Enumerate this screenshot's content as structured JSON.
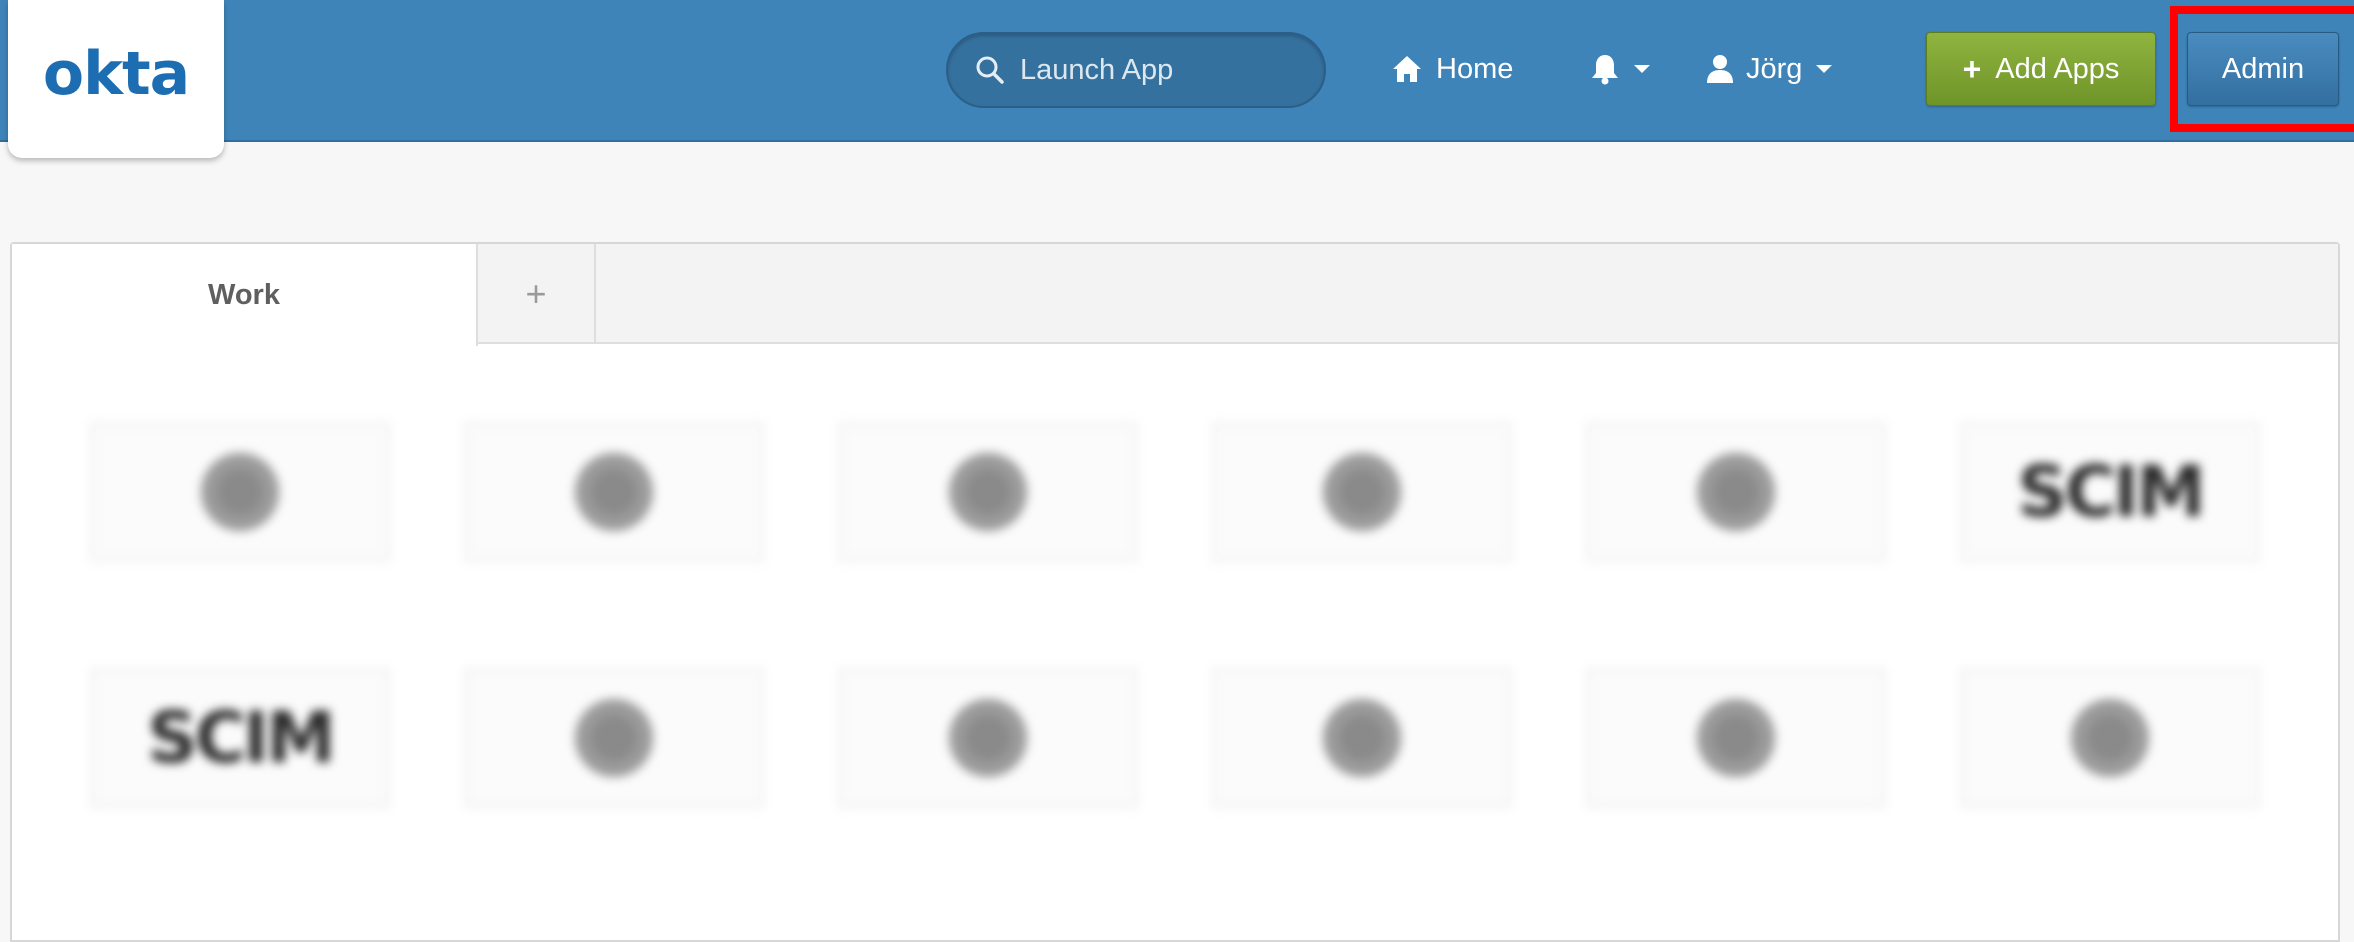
{
  "header": {
    "logo": "okta",
    "search_placeholder": "Launch App",
    "home_label": "Home",
    "user_label": "Jörg",
    "add_apps_label": "Add Apps",
    "admin_label": "Admin"
  },
  "tabs": {
    "work_label": "Work",
    "add_label": "+"
  },
  "apps": [
    {
      "icon": "gear-icon",
      "label": "",
      "row": 1
    },
    {
      "icon": "gear-icon",
      "label": "",
      "row": 1
    },
    {
      "icon": "gear-icon",
      "label": "",
      "row": 1
    },
    {
      "icon": "gear-icon",
      "label": "",
      "row": 1
    },
    {
      "icon": "gear-icon",
      "label": "",
      "row": 1
    },
    {
      "icon": "scim-logo",
      "label": "",
      "row": 1
    },
    {
      "icon": "scim-logo",
      "label": "",
      "row": 2
    },
    {
      "icon": "gear-icon",
      "label": "",
      "row": 2
    },
    {
      "icon": "gear-icon",
      "label": "",
      "row": 2
    },
    {
      "icon": "gear-icon",
      "label": "",
      "row": 2
    },
    {
      "icon": "gear-icon",
      "label": "",
      "row": 2
    },
    {
      "icon": "gear-icon",
      "label": "",
      "row": 2
    }
  ],
  "colors": {
    "header_bg": "#3f84b9",
    "add_apps_bg": "#7ea334",
    "admin_bg": "#3f7eb0",
    "highlight": "#ff0000"
  }
}
